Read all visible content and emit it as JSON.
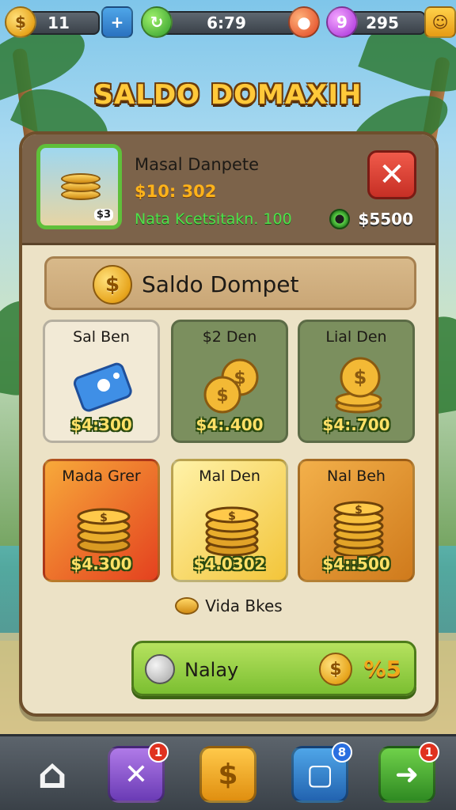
{
  "hud": {
    "coins": "11",
    "plus_icon": "plus-icon",
    "timer": "6:79",
    "gems": "295",
    "level_badge": "9"
  },
  "title": "SALDO DOMAXIH",
  "header": {
    "name": "Masal Danpete",
    "price": "$10: 302",
    "subtitle": "Nata Kcetsitakn. 100",
    "thumb_badge": "$3",
    "balance": "$5500",
    "close_label": "✕"
  },
  "banner": {
    "label": "Saldo Dompet"
  },
  "items": [
    {
      "name": "Sal Ben",
      "price": "$4:300",
      "art": "card-icon",
      "bg": "#f2ead6"
    },
    {
      "name": "$2 Den",
      "price": "$4:.400",
      "art": "coin-pile-icon",
      "bg": "#7b8f5e"
    },
    {
      "name": "Lial Den",
      "price": "$4:.700",
      "art": "coin-pile-icon",
      "bg": "#7b8f5e"
    },
    {
      "name": "Mada Grer",
      "price": "$4.300",
      "art": "coin-stack-icon",
      "bg": "#ef6f2a"
    },
    {
      "name": "Mal Den",
      "price": "$4.0302",
      "art": "coin-stack-icon",
      "bg": "#f6d86a"
    },
    {
      "name": "Nal Beh",
      "price": "$4::500",
      "art": "coin-stack-icon",
      "bg": "#e49a34"
    }
  ],
  "more_link": "Vida Bkes",
  "pay": {
    "label": "Nalay",
    "amount": "%5"
  },
  "nav": {
    "items": [
      {
        "icon": "home-icon"
      },
      {
        "icon": "sword-icon",
        "badge": "1"
      },
      {
        "icon": "coin-icon"
      },
      {
        "icon": "screen-icon",
        "badge": "8"
      },
      {
        "icon": "arrow-icon",
        "badge": "1"
      }
    ]
  },
  "colors": {
    "accent_gold": "#ffc93a",
    "panel": "#ece2c6",
    "header": "#7c634a",
    "pay_green": "#7bbf31",
    "close_red": "#c62f25"
  }
}
